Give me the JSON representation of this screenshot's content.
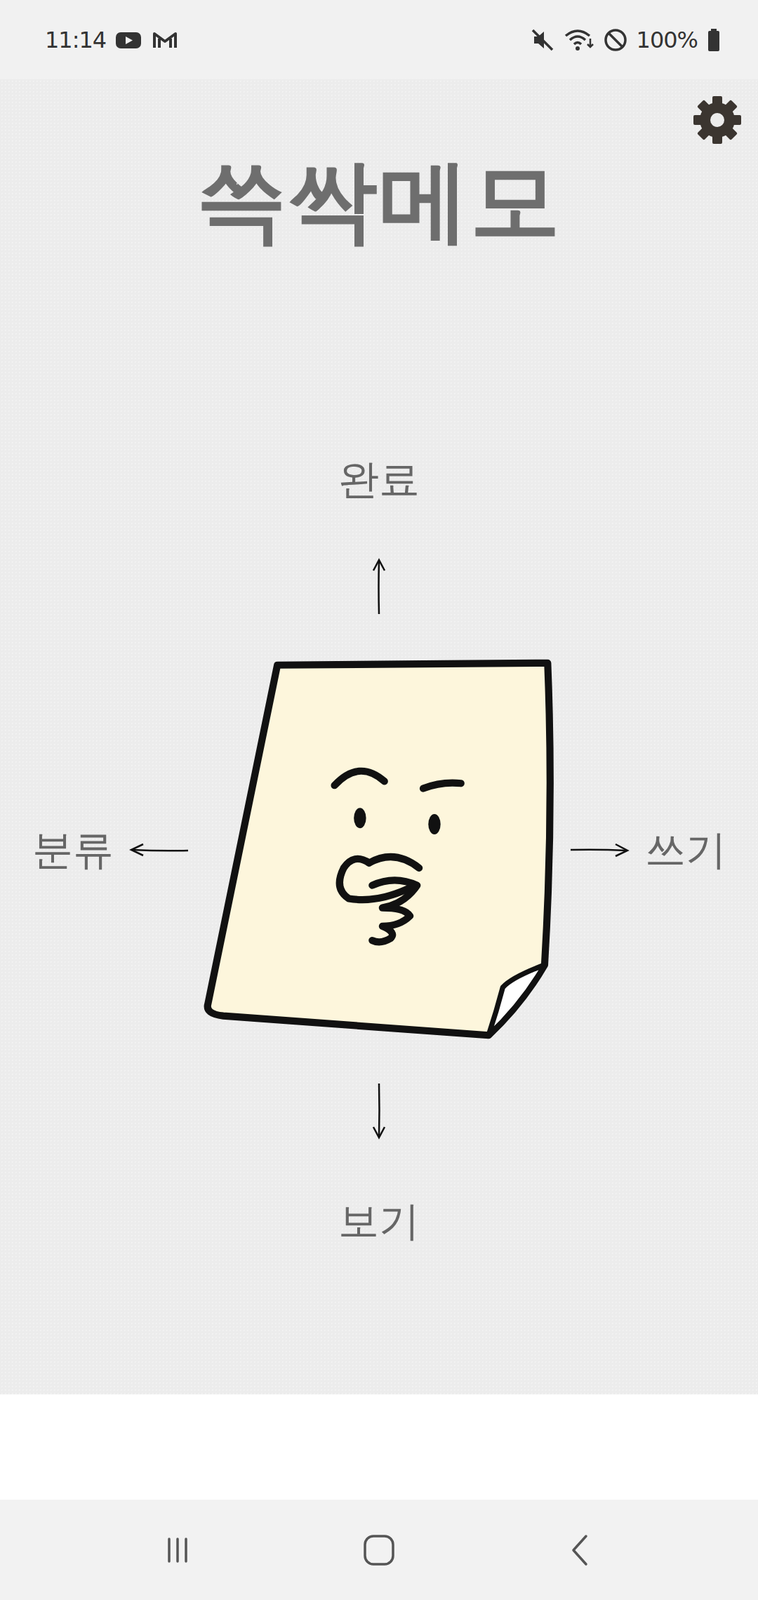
{
  "status_bar": {
    "time": "11:14",
    "battery": "100%"
  },
  "title": "쓱싹메모",
  "directions": {
    "up": "완료",
    "left": "분류",
    "right": "쓰기",
    "down": "보기"
  }
}
